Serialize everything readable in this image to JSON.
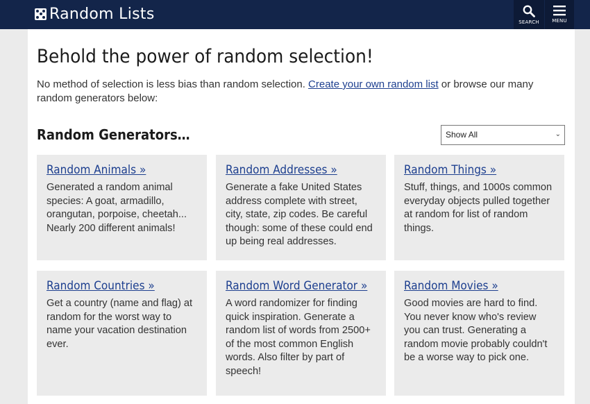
{
  "header": {
    "site_name": "Random Lists",
    "search_label": "SEARCH",
    "menu_label": "MENU"
  },
  "page": {
    "headline": "Behold the power of random selection!",
    "intro_before": "No method of selection is less bias than random selection. ",
    "intro_link": "Create your own random list",
    "intro_after": " or browse our many random generators below:",
    "section_title": "Random Generators…",
    "filter_value": "Show All"
  },
  "tiles": [
    {
      "title": "Random Animals »",
      "desc": "Generated a random animal species: A goat, armadillo, orangutan, porpoise, cheetah... Nearly 200 different animals!"
    },
    {
      "title": "Random Addresses »",
      "desc": "Generate a fake United States address complete with street, city, state, zip codes. Be careful though: some of these could end up being real addresses."
    },
    {
      "title": "Random Things »",
      "desc": "Stuff, things, and 1000s common everyday objects pulled together at random for list of random things."
    },
    {
      "title": "Random Countries »",
      "desc": "Get a country (name and flag) at random for the worst way to name your vacation destination ever."
    },
    {
      "title": "Random Word Generator »",
      "desc": "A word randomizer for finding quick inspiration. Generate a random list of words from 2500+ of the most common English words. Also filter by part of speech!"
    },
    {
      "title": "Random Movies »",
      "desc": "Good movies are hard to find. You never know who's review you can trust. Generating a random movie probably couldn't be a worse way to pick one."
    }
  ],
  "colors": {
    "header_bg": "#13254a",
    "link": "#1d3f8f",
    "tile_bg": "#ebebeb"
  },
  "icons": {
    "logo": "dice-icon",
    "search": "search-icon",
    "menu": "hamburger-menu-icon"
  }
}
